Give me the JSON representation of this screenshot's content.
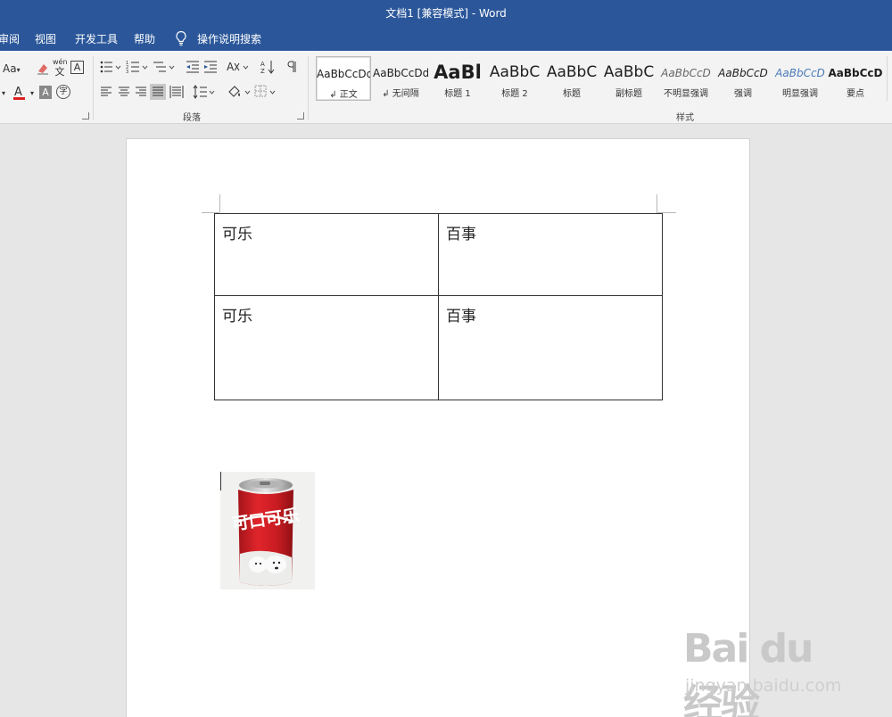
{
  "window": {
    "title": "文档1 [兼容模式]  -  Word"
  },
  "tabs": [
    "审阅",
    "视图",
    "开发工具",
    "帮助"
  ],
  "tell_me": "操作说明搜索",
  "ribbon": {
    "font_group": {
      "change_case": "Aa",
      "phonetic_top": "wén",
      "phonetic_bottom": "文"
    },
    "paragraph_group": {
      "label": "段落"
    },
    "styles_group": {
      "label": "样式",
      "items": [
        {
          "preview": "AaBbCcDd",
          "name": "↲ 正文"
        },
        {
          "preview": "AaBbCcDd",
          "name": "↲ 无间隔"
        },
        {
          "preview": "AaBl",
          "name": "标题 1"
        },
        {
          "preview": "AaBbC",
          "name": "标题 2"
        },
        {
          "preview": "AaBbC",
          "name": "标题"
        },
        {
          "preview": "AaBbC",
          "name": "副标题"
        },
        {
          "preview": "AaBbCcD",
          "name": "不明显强调"
        },
        {
          "preview": "AaBbCcD",
          "name": "强调"
        },
        {
          "preview": "AaBbCcD",
          "name": "明显强调"
        },
        {
          "preview": "AaBbCcD",
          "name": "要点"
        }
      ]
    }
  },
  "document": {
    "table": [
      [
        "可乐",
        "百事"
      ],
      [
        "可乐",
        "百事"
      ]
    ],
    "image": {
      "can_text": "可口可乐"
    }
  },
  "watermark": {
    "logo": "Bai  du 经验",
    "sub": "jingyan.baidu.com"
  },
  "colors": {
    "title_bar": "#2b579a",
    "ribbon": "#f3f3f3",
    "canvas": "#e6e6e6",
    "font_color_red": "#e02020"
  }
}
